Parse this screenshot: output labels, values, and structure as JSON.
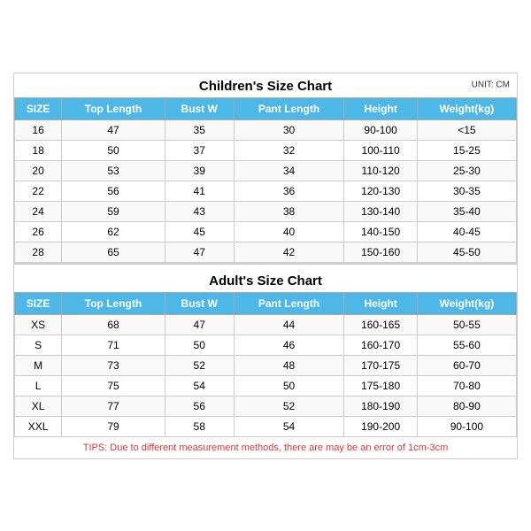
{
  "children": {
    "title": "Children's Size Chart",
    "unit": "UNIT: CM",
    "headers": [
      "SIZE",
      "Top Length",
      "Bust W",
      "Pant Length",
      "Height",
      "Weight(kg)"
    ],
    "rows": [
      [
        "16",
        "47",
        "35",
        "30",
        "90-100",
        "<15"
      ],
      [
        "18",
        "50",
        "37",
        "32",
        "100-110",
        "15-25"
      ],
      [
        "20",
        "53",
        "39",
        "34",
        "110-120",
        "25-30"
      ],
      [
        "22",
        "56",
        "41",
        "36",
        "120-130",
        "30-35"
      ],
      [
        "24",
        "59",
        "43",
        "38",
        "130-140",
        "35-40"
      ],
      [
        "26",
        "62",
        "45",
        "40",
        "140-150",
        "40-45"
      ],
      [
        "28",
        "65",
        "47",
        "42",
        "150-160",
        "45-50"
      ]
    ]
  },
  "adult": {
    "title": "Adult's Size Chart",
    "headers": [
      "SIZE",
      "Top Length",
      "Bust W",
      "Pant Length",
      "Height",
      "Weight(kg)"
    ],
    "rows": [
      [
        "XS",
        "68",
        "47",
        "44",
        "160-165",
        "50-55"
      ],
      [
        "S",
        "71",
        "50",
        "46",
        "160-170",
        "55-60"
      ],
      [
        "M",
        "73",
        "52",
        "48",
        "170-175",
        "60-70"
      ],
      [
        "L",
        "75",
        "54",
        "50",
        "175-180",
        "70-80"
      ],
      [
        "XL",
        "77",
        "56",
        "52",
        "180-190",
        "80-90"
      ],
      [
        "XXL",
        "79",
        "58",
        "54",
        "190-200",
        "90-100"
      ]
    ]
  },
  "tips": "TIPS: Due to different measurement methods, there are may be an error of 1cm-3cm"
}
